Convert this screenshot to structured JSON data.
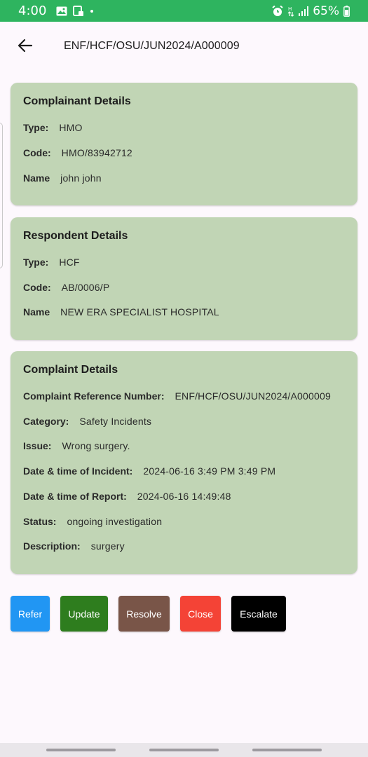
{
  "status_bar": {
    "time": "4:00",
    "battery": "65%",
    "icons": [
      "image-icon",
      "screenshot-icon",
      "dot-icon",
      "alarm-icon",
      "data-icon",
      "signal-icon",
      "battery-icon"
    ]
  },
  "app_bar": {
    "back_icon": "arrow-left-icon",
    "title": "ENF/HCF/OSU/JUN2024/A000009"
  },
  "complainant": {
    "title": "Complainant Details",
    "rows": [
      {
        "label": "Type:",
        "value": "HMO"
      },
      {
        "label": "Code:",
        "value": "HMO/83942712"
      },
      {
        "label": "Name",
        "value": "john john"
      }
    ]
  },
  "respondent": {
    "title": "Respondent Details",
    "rows": [
      {
        "label": "Type:",
        "value": "HCF"
      },
      {
        "label": "Code:",
        "value": "AB/0006/P"
      },
      {
        "label": "Name",
        "value": "NEW ERA SPECIALIST HOSPITAL"
      }
    ]
  },
  "complaint": {
    "title": "Complaint Details",
    "rows": [
      {
        "label": "Complaint Reference Number:",
        "value": "ENF/HCF/OSU/JUN2024/A000009"
      },
      {
        "label": "Category:",
        "value": "Safety Incidents"
      },
      {
        "label": "Issue:",
        "value": "Wrong surgery."
      },
      {
        "label": "Date & time of Incident:",
        "value": "2024-06-16 3:49 PM 3:49 PM"
      },
      {
        "label": "Date & time of Report:",
        "value": "2024-06-16 14:49:48"
      },
      {
        "label": "Status:",
        "value": "ongoing investigation"
      },
      {
        "label": "Description:",
        "value": "surgery"
      }
    ]
  },
  "actions": [
    {
      "label": "Refer",
      "color": "#2196f3"
    },
    {
      "label": "Update",
      "color": "#2e7d1e"
    },
    {
      "label": "Resolve",
      "color": "#795548"
    },
    {
      "label": "Close",
      "color": "#f44336"
    },
    {
      "label": "Escalate",
      "color": "#000000"
    }
  ],
  "colors": {
    "status_bar": "#2eb45f",
    "card_background": "#c1d5b5",
    "page_background": "#fdf8fd"
  }
}
